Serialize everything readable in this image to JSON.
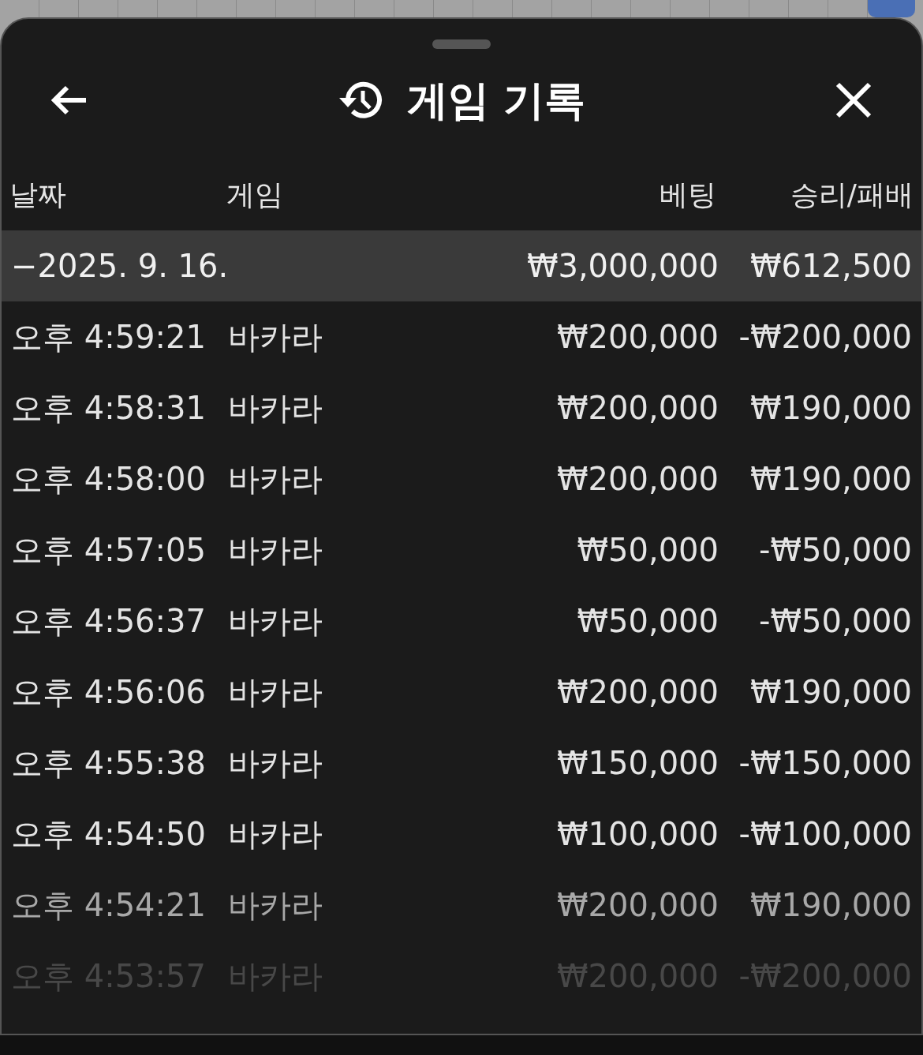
{
  "header": {
    "title": "게임 기록"
  },
  "columns": [
    {
      "label": "날짜"
    },
    {
      "label": "게임"
    },
    {
      "label": "베팅"
    },
    {
      "label": "승리/패배"
    }
  ],
  "group": {
    "toggle": "−",
    "date": "2025. 9. 16.",
    "bet": "₩3,000,000",
    "result": "₩612,500"
  },
  "rows": [
    {
      "time": "오후 4:59:21",
      "game": "바카라",
      "bet": "₩200,000",
      "result": "-₩200,000"
    },
    {
      "time": "오후 4:58:31",
      "game": "바카라",
      "bet": "₩200,000",
      "result": "₩190,000"
    },
    {
      "time": "오후 4:58:00",
      "game": "바카라",
      "bet": "₩200,000",
      "result": "₩190,000"
    },
    {
      "time": "오후 4:57:05",
      "game": "바카라",
      "bet": "₩50,000",
      "result": "-₩50,000"
    },
    {
      "time": "오후 4:56:37",
      "game": "바카라",
      "bet": "₩50,000",
      "result": "-₩50,000"
    },
    {
      "time": "오후 4:56:06",
      "game": "바카라",
      "bet": "₩200,000",
      "result": "₩190,000"
    },
    {
      "time": "오후 4:55:38",
      "game": "바카라",
      "bet": "₩150,000",
      "result": "-₩150,000"
    },
    {
      "time": "오후 4:54:50",
      "game": "바카라",
      "bet": "₩100,000",
      "result": "-₩100,000"
    },
    {
      "time": "오후 4:54:21",
      "game": "바카라",
      "bet": "₩200,000",
      "result": "₩190,000"
    },
    {
      "time": "오후 4:53:57",
      "game": "바카라",
      "bet": "₩200,000",
      "result": "-₩200,000"
    }
  ]
}
